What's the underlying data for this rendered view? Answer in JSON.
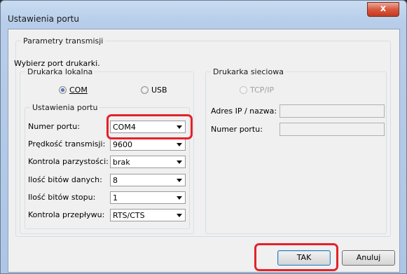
{
  "window": {
    "title": "Ustawienia portu",
    "close_glyph": "x"
  },
  "transmission": {
    "legend": "Parametry transmisji",
    "choose_port": "Wybierz port drukarki.",
    "local": {
      "legend": "Drukarka lokalna",
      "com_label": "COM",
      "usb_label": "USB",
      "selected": "COM",
      "port_settings": {
        "legend": "Ustawienia portu",
        "rows": [
          {
            "label": "Numer portu:",
            "value": "COM4"
          },
          {
            "label": "Prędkość transmisji:",
            "value": "9600"
          },
          {
            "label": "Kontrola parzystości:",
            "value": "brak"
          },
          {
            "label": "Ilość bitów danych:",
            "value": "8"
          },
          {
            "label": "Ilość bitów stopu:",
            "value": "1"
          },
          {
            "label": "Kontrola przepływu:",
            "value": "RTS/CTS"
          }
        ]
      }
    },
    "network": {
      "legend": "Drukarka sieciowa",
      "tcp_label": "TCP/IP",
      "ip_label": "Adres IP / nazwa:",
      "port_label": "Numer portu:",
      "ip_value": "",
      "port_value": ""
    }
  },
  "buttons": {
    "ok": "TAK",
    "cancel": "Anuluj"
  },
  "colors": {
    "highlight": "#e3222a",
    "close": "#d9573e"
  }
}
